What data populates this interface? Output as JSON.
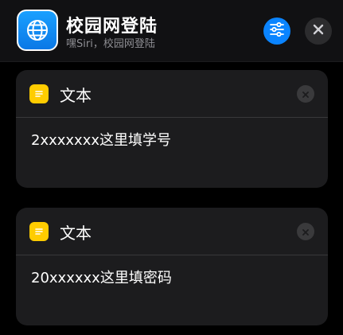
{
  "header": {
    "title": "校园网登陆",
    "subtitle": "嘿Siri，校园网登陆",
    "app_icon": "globe-icon",
    "settings_icon": "sliders-icon",
    "close_icon": "close-icon"
  },
  "cards": [
    {
      "title": "文本",
      "icon": "note-icon",
      "value": "2xxxxxxx这里填学号"
    },
    {
      "title": "文本",
      "icon": "note-icon",
      "value": "20xxxxxx这里填密码"
    }
  ],
  "colors": {
    "accent": "#0a84ff",
    "note_icon": "#ffcc00",
    "card_bg": "#1c1c1e",
    "background": "#000000"
  }
}
